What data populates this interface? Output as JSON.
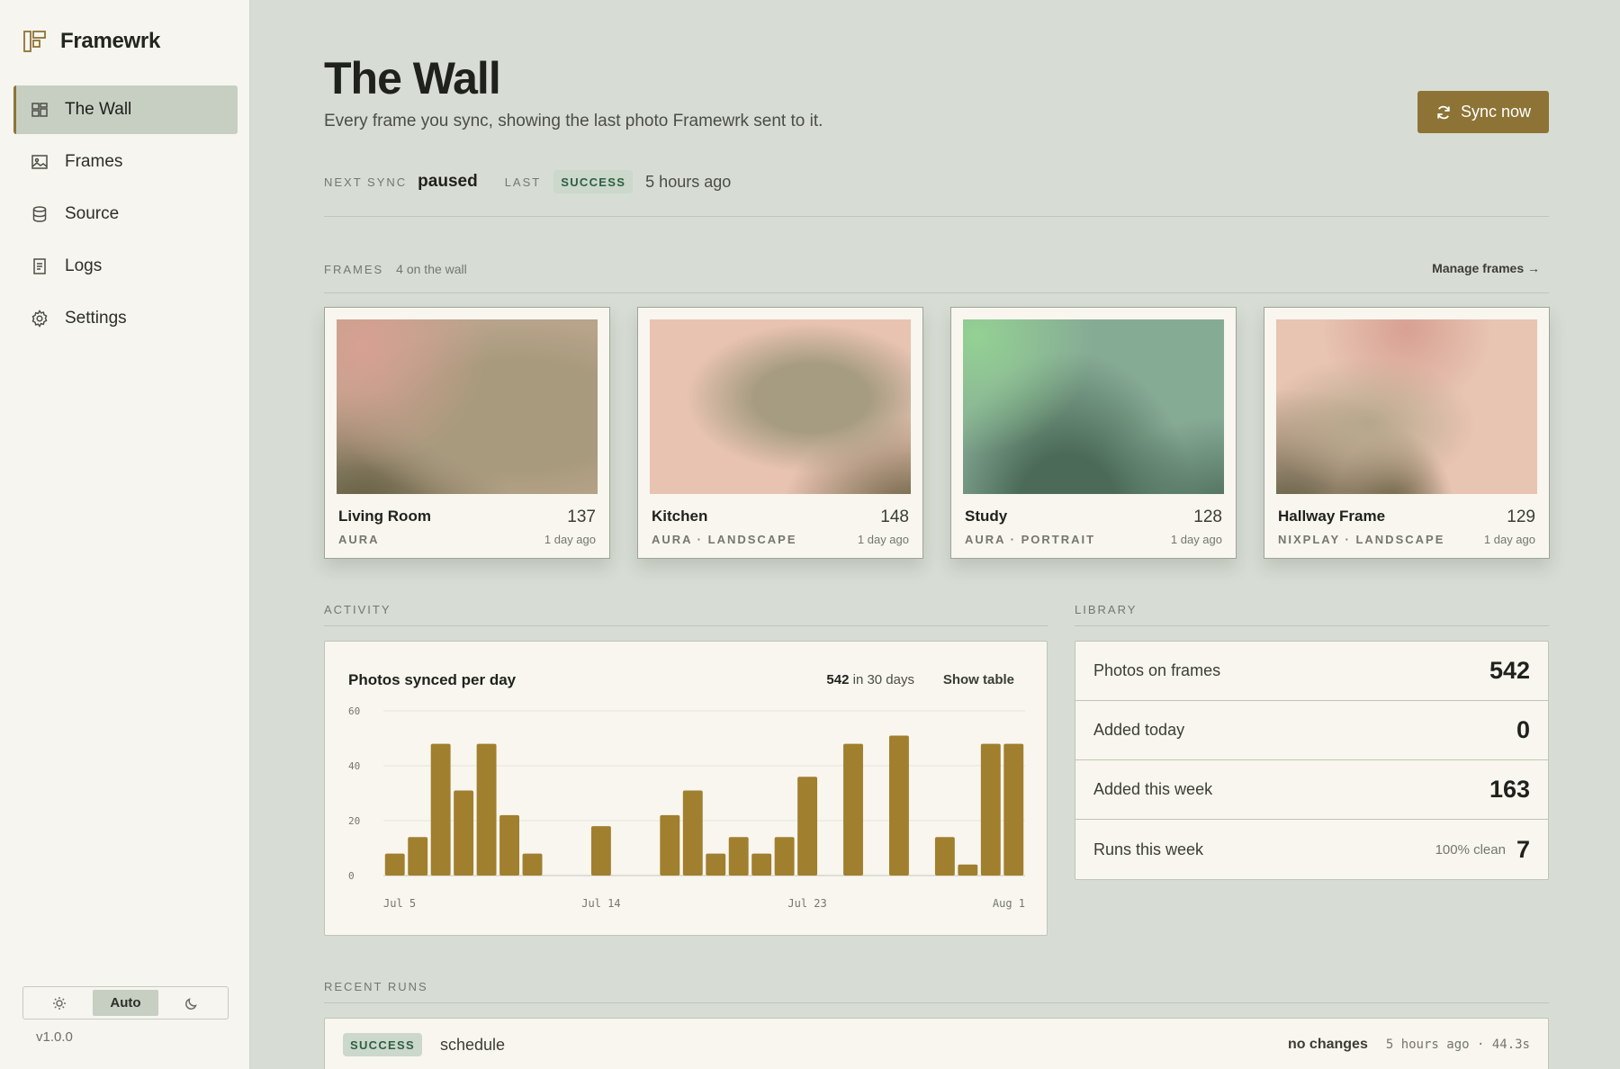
{
  "app": {
    "name": "Framewrk",
    "version": "v1.0.0"
  },
  "sidebar": {
    "items": [
      {
        "label": "The Wall",
        "icon": "grid-icon",
        "active": true
      },
      {
        "label": "Frames",
        "icon": "image-icon",
        "active": false
      },
      {
        "label": "Source",
        "icon": "database-icon",
        "active": false
      },
      {
        "label": "Logs",
        "icon": "document-icon",
        "active": false
      },
      {
        "label": "Settings",
        "icon": "gear-icon",
        "active": false
      }
    ],
    "theme": {
      "options": [
        "light",
        "Auto",
        "dark"
      ],
      "selected": "Auto"
    }
  },
  "header": {
    "title": "The Wall",
    "subtitle": "Every frame you sync, showing the last photo Framewrk sent to it.",
    "sync_button": "Sync now"
  },
  "status": {
    "next_sync_label": "NEXT SYNC",
    "next_sync_value": "paused",
    "last_label": "LAST",
    "last_badge": "SUCCESS",
    "last_time": "5 hours ago"
  },
  "frames_section": {
    "label": "FRAMES",
    "sub": "4 on the wall",
    "manage_link": "Manage frames →",
    "frames": [
      {
        "name": "Living Room",
        "count": "137",
        "meta": "AURA",
        "ago": "1 day ago"
      },
      {
        "name": "Kitchen",
        "count": "148",
        "meta": "AURA · LANDSCAPE",
        "ago": "1 day ago"
      },
      {
        "name": "Study",
        "count": "128",
        "meta": "AURA · PORTRAIT",
        "ago": "1 day ago"
      },
      {
        "name": "Hallway Frame",
        "count": "129",
        "meta": "NIXPLAY · LANDSCAPE",
        "ago": "1 day ago"
      }
    ]
  },
  "activity": {
    "label": "ACTIVITY",
    "title": "Photos synced per day",
    "total_value": "542",
    "total_suffix": "in 30 days",
    "show_table": "Show table"
  },
  "chart_data": {
    "type": "bar",
    "title": "Photos synced per day",
    "ylim": [
      0,
      60
    ],
    "yticks": [
      60,
      40,
      20,
      0
    ],
    "xtick_labels": [
      {
        "index": 0,
        "label": "Jul 5"
      },
      {
        "index": 9,
        "label": "Jul 14"
      },
      {
        "index": 18,
        "label": "Jul 23"
      },
      {
        "index": 27,
        "label": "Aug 1"
      }
    ],
    "values": [
      8,
      14,
      48,
      31,
      48,
      22,
      8,
      0,
      0,
      18,
      0,
      0,
      22,
      31,
      8,
      14,
      8,
      14,
      36,
      0,
      48,
      0,
      51,
      0,
      14,
      4,
      48,
      48
    ],
    "bar_color": "#a07f2e"
  },
  "library": {
    "label": "LIBRARY",
    "rows": [
      {
        "label": "Photos on frames",
        "note": "",
        "value": "542"
      },
      {
        "label": "Added today",
        "note": "",
        "value": "0"
      },
      {
        "label": "Added this week",
        "note": "",
        "value": "163"
      },
      {
        "label": "Runs this week",
        "note": "100% clean",
        "value": "7"
      }
    ]
  },
  "recent_runs": {
    "label": "RECENT RUNS",
    "runs": [
      {
        "status": "SUCCESS",
        "name": "schedule",
        "result": "no changes",
        "meta": "5 hours ago · 44.3s"
      }
    ]
  },
  "colors": {
    "accent": "#8d7436",
    "success_bg": "#cbd8cb",
    "success_text": "#2f5f43",
    "background": "#d7ddd4"
  }
}
